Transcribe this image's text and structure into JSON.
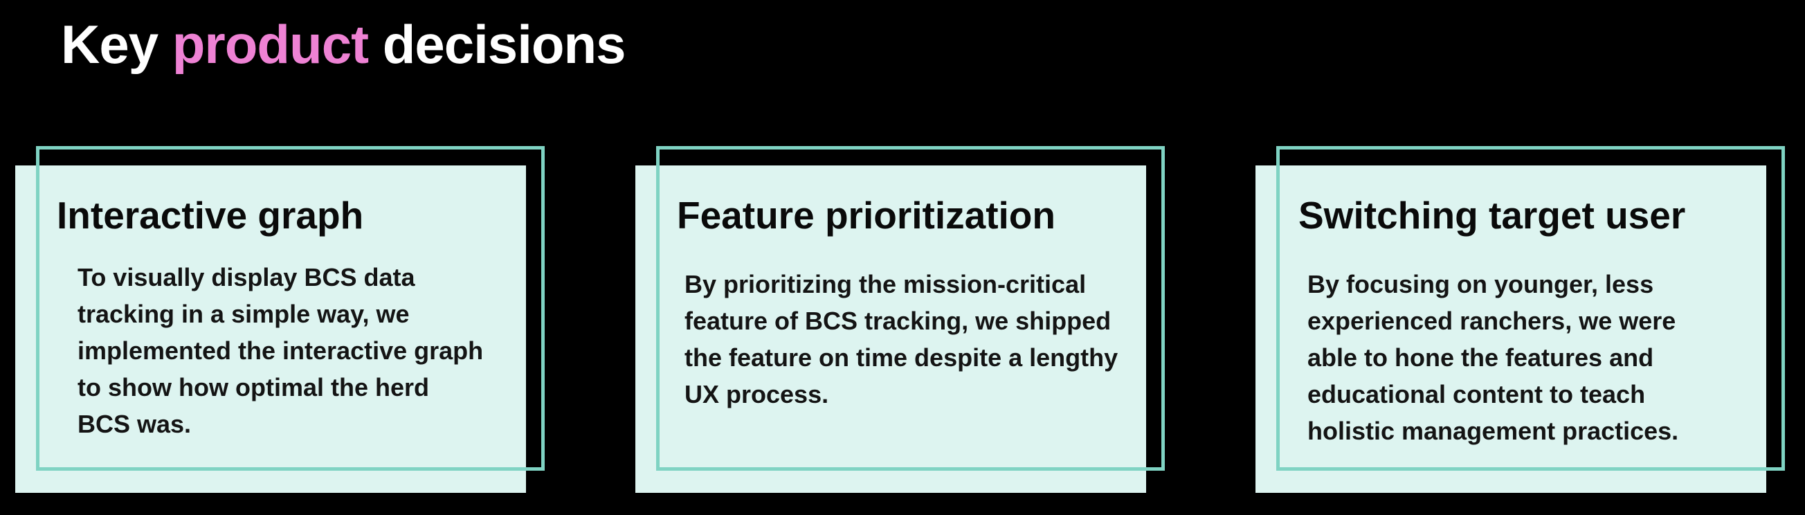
{
  "title": {
    "part1": "Key ",
    "accent": "product",
    "part2": " decisions"
  },
  "colors": {
    "background": "#000000",
    "card_fill": "#ddf4f0",
    "card_frame": "#7fd3c3",
    "accent": "#ee82d4"
  },
  "cards": [
    {
      "heading": "Interactive graph",
      "body": "To visually display BCS data tracking in a simple way, we implemented the interactive graph to show how optimal the herd BCS was."
    },
    {
      "heading": "Feature prioritization",
      "body": "By prioritizing the mission-critical feature of BCS tracking, we shipped the feature on time despite a lengthy UX process."
    },
    {
      "heading": "Switching target user",
      "body": "By focusing on younger, less experienced ranchers, we were able to hone the features and educational content to teach holistic management practices."
    }
  ]
}
